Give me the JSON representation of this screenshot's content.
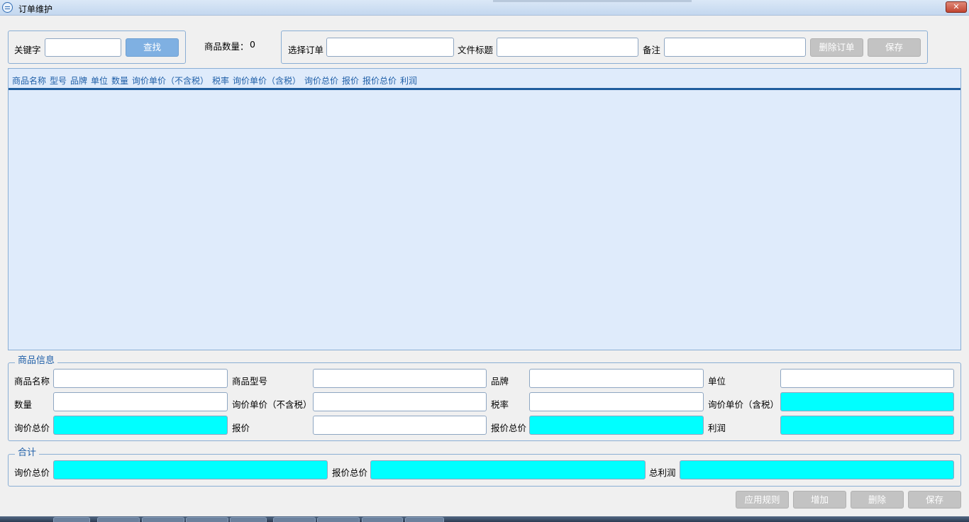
{
  "window": {
    "title": "订单维护",
    "close_label": "✕"
  },
  "search": {
    "keyword_label": "关键字",
    "keyword_value": "",
    "find_button": "查找",
    "count_label": "商品数量：",
    "count_value": "0"
  },
  "order": {
    "select_label": "选择订单",
    "select_value": "",
    "file_title_label": "文件标题",
    "file_title_value": "",
    "remark_label": "备注",
    "remark_value": "",
    "delete_button": "删除订单",
    "save_button": "保存"
  },
  "grid": {
    "columns": [
      "商品名称",
      "型号",
      "品牌",
      "单位",
      "数量",
      "询价单价（不含税）",
      "税率",
      "询价单价（含税）",
      "询价总价",
      "报价",
      "报价总价",
      "利润"
    ],
    "rows": []
  },
  "product_info": {
    "legend": "商品信息",
    "name_label": "商品名称",
    "model_label": "商品型号",
    "brand_label": "品牌",
    "unit_label": "单位",
    "qty_label": "数量",
    "inq_price_notax_label": "询价单价（不含税）",
    "tax_rate_label": "税率",
    "inq_price_tax_label": "询价单价（含税）",
    "inq_total_label": "询价总价",
    "quote_label": "报价",
    "quote_total_label": "报价总价",
    "profit_label": "利润"
  },
  "totals": {
    "legend": "合计",
    "inq_total_label": "询价总价",
    "quote_total_label": "报价总价",
    "total_profit_label": "总利润"
  },
  "bottom_buttons": {
    "apply_rules": "应用规则",
    "add": "增加",
    "delete": "删除",
    "save": "保存"
  },
  "colors": {
    "accent_blue": "#1f5fa8",
    "grid_background": "#dfebfb",
    "computed_field": "#00ffff"
  }
}
